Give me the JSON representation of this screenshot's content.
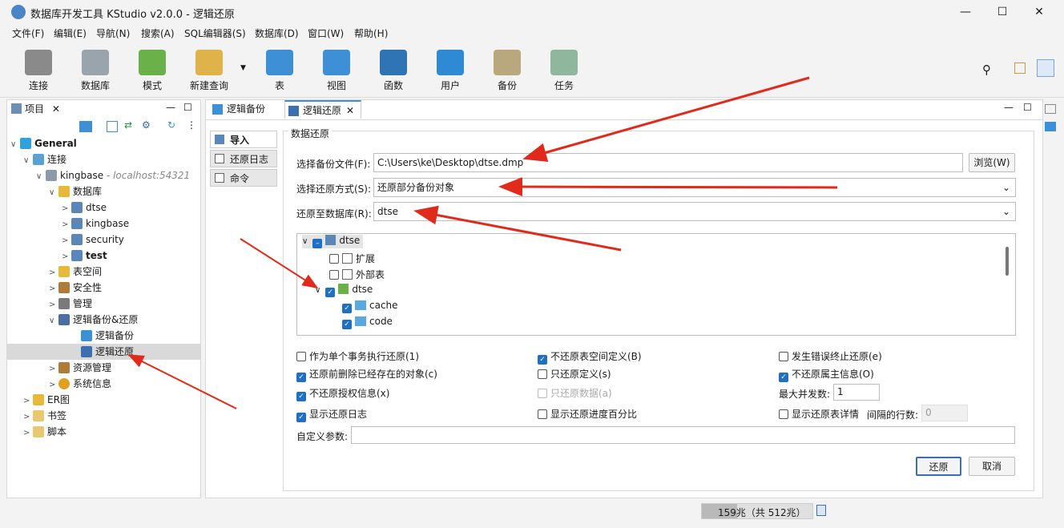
{
  "window": {
    "title": "数据库开发工具 KStudio v2.0.0 - 逻辑还原",
    "minimize": "—",
    "maximize": "☐",
    "close": "✕"
  },
  "menu": [
    "文件(F)",
    "编辑(E)",
    "导航(N)",
    "搜索(A)",
    "SQL编辑器(S)",
    "数据库(D)",
    "窗口(W)",
    "帮助(H)"
  ],
  "toolbar": [
    {
      "label": "连接",
      "icon": "plug-icon",
      "color": "#8a8a8a"
    },
    {
      "label": "数据库",
      "icon": "database-icon",
      "color": "#9aa4ad"
    },
    {
      "label": "模式",
      "icon": "schema-icon",
      "color": "#6bb14a"
    },
    {
      "label": "新建查询",
      "icon": "query-icon",
      "color": "#e0b34a"
    },
    {
      "label": "表",
      "icon": "table-icon",
      "color": "#3d8fd6"
    },
    {
      "label": "视图",
      "icon": "view-icon",
      "color": "#3d8fd6"
    },
    {
      "label": "函数",
      "icon": "function-icon",
      "color": "#2f74b5"
    },
    {
      "label": "用户",
      "icon": "user-icon",
      "color": "#2f8ad6"
    },
    {
      "label": "备份",
      "icon": "backup-icon",
      "color": "#b9a77d"
    },
    {
      "label": "任务",
      "icon": "task-icon",
      "color": "#8fb79d"
    }
  ],
  "left_panel": {
    "tab": "项目",
    "tree": [
      {
        "label": "General",
        "bold": true,
        "arrow": "∨"
      },
      {
        "label": "连接",
        "arrow": "∨"
      },
      {
        "label": "kingbase",
        "suffix": " - localhost:54321",
        "arrow": "∨"
      },
      {
        "label": "数据库",
        "arrow": "∨"
      },
      {
        "label": "dtse",
        "arrow": ">"
      },
      {
        "label": "kingbase",
        "arrow": ">"
      },
      {
        "label": "security",
        "arrow": ">"
      },
      {
        "label": "test",
        "bold": true,
        "arrow": ">"
      },
      {
        "label": "表空间",
        "arrow": ">"
      },
      {
        "label": "安全性",
        "arrow": ">"
      },
      {
        "label": "管理",
        "arrow": ">"
      },
      {
        "label": "逻辑备份&还原",
        "arrow": "∨"
      },
      {
        "label": "逻辑备份",
        "arrow": ""
      },
      {
        "label": "逻辑还原",
        "arrow": "",
        "selected": true
      },
      {
        "label": "资源管理",
        "arrow": ">"
      },
      {
        "label": "系统信息",
        "arrow": ">"
      },
      {
        "label": "ER图",
        "arrow": ">"
      },
      {
        "label": "书签",
        "arrow": ">"
      },
      {
        "label": "脚本",
        "arrow": ">"
      }
    ]
  },
  "editor_tabs": [
    {
      "label": "逻辑备份"
    },
    {
      "label": "逻辑还原",
      "close": "✕"
    }
  ],
  "side_tabs": [
    "导入",
    "还原日志",
    "命令"
  ],
  "form": {
    "section": "数据还原",
    "file_label": "选择备份文件(F):",
    "file_value": "C:\\Users\\ke\\Desktop\\dtse.dmp",
    "browse": "浏览(W)",
    "mode_label": "选择还原方式(S):",
    "mode_value": "还原部分备份对象",
    "db_label": "还原至数据库(R):",
    "db_value": "dtse",
    "tree": [
      {
        "label": "dtse",
        "state": "partial",
        "arrow": "∨",
        "indent": 0
      },
      {
        "label": "扩展",
        "state": "off",
        "arrow": "",
        "indent": 1
      },
      {
        "label": "外部表",
        "state": "off",
        "arrow": "",
        "indent": 1
      },
      {
        "label": "dtse",
        "state": "on",
        "arrow": "∨",
        "indent": 1
      },
      {
        "label": "cache",
        "state": "on",
        "arrow": "",
        "indent": 2
      },
      {
        "label": "code",
        "state": "on",
        "arrow": "",
        "indent": 2
      }
    ],
    "options": [
      {
        "label": "作为单个事务执行还原(1)",
        "state": "off"
      },
      {
        "label": "不还原表空间定义(B)",
        "state": "on"
      },
      {
        "label": "发生错误终止还原(e)",
        "state": "off"
      },
      {
        "label": "还原前删除已经存在的对象(c)",
        "state": "on"
      },
      {
        "label": "只还原定义(s)",
        "state": "off"
      },
      {
        "label": "不还原属主信息(O)",
        "state": "on"
      },
      {
        "label": "不还原授权信息(x)",
        "state": "on"
      },
      {
        "label": "只还原数据(a)",
        "state": "disabled"
      },
      {
        "label": "显示还原日志",
        "state": "on"
      },
      {
        "label": "显示还原进度百分比",
        "state": "off"
      },
      {
        "label": "显示还原表详情",
        "state": "off"
      }
    ],
    "max_jobs_label": "最大并发数:",
    "max_jobs_value": "1",
    "rows_label": "间隔的行数:",
    "rows_value": "0",
    "custom_label": "自定义参数:",
    "custom_value": "",
    "restore_btn": "还原",
    "cancel_btn": "取消"
  },
  "status": {
    "memory": "159兆（共 512兆）"
  }
}
